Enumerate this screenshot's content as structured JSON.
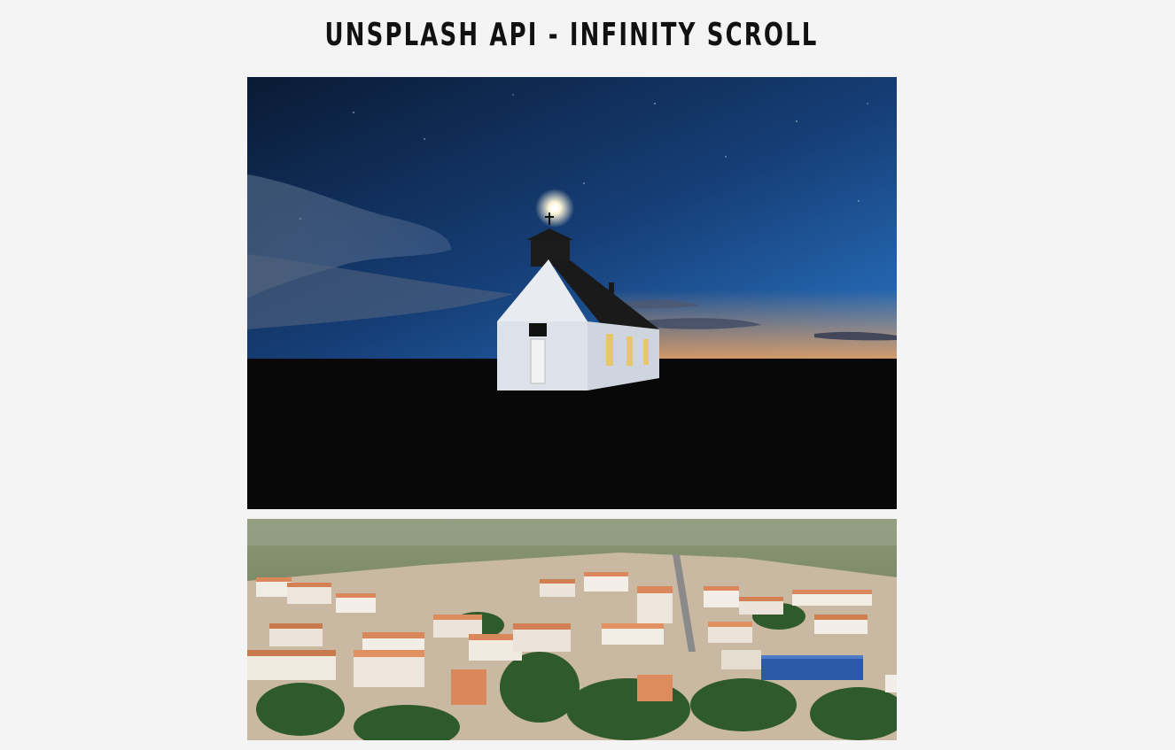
{
  "header": {
    "title": "UNSPLASH API - INFINITY SCROLL"
  },
  "photos": [
    {
      "alt": "",
      "colors": {
        "sky_top": "#0b1b33",
        "sky_bottom": "#1f5d9c",
        "horizon": "#f0a25a",
        "ground": "#0a0a0a"
      }
    },
    {
      "alt": "",
      "colors": {
        "forest": "#7c8a5f",
        "roof": "#d8875a",
        "walls": "#eee7de",
        "trees": "#2f5a2c"
      }
    }
  ]
}
